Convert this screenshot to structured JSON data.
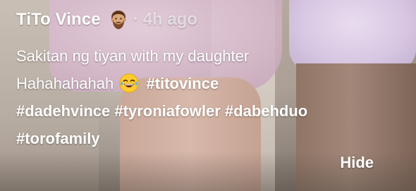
{
  "post": {
    "username": "TiTo Vince",
    "avatar_icon": "bearded-man-emoji-icon",
    "separator": "·",
    "time_ago": "4h ago",
    "caption": {
      "line1": "Sakitan ng tiyan with my daughter",
      "line2_text": "Hahahahahah",
      "line2_emoji": "laughing-tears-emoji-icon",
      "hashtags": [
        "#titovince",
        "#dadehvince",
        "#tyroniafowler",
        "#dabehduo",
        "#torofamily"
      ]
    },
    "hide_label": "Hide"
  },
  "colors": {
    "text": "#ffffff",
    "timestamp": "rgba(255,255,255,0.62)"
  }
}
